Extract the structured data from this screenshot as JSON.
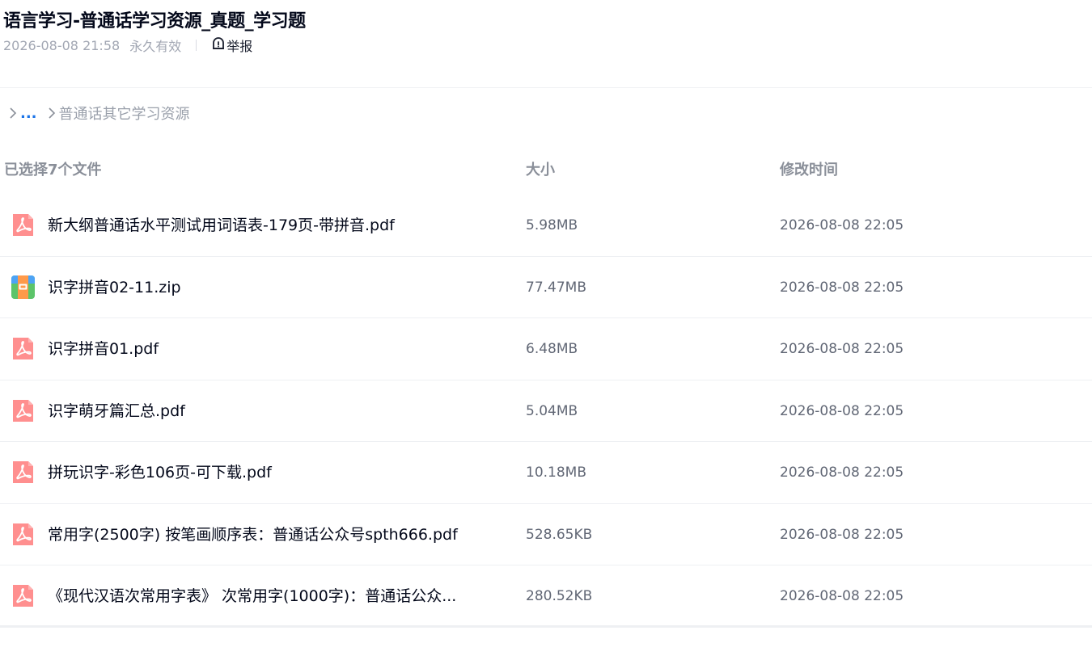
{
  "share": {
    "title": "语言学习-普通话学习资源_真题_学习题",
    "date": "2026-08-08 21:58",
    "validity": "永久有效",
    "report_label": "举报"
  },
  "breadcrumb": {
    "more": "...",
    "current": "普通话其它学习资源"
  },
  "columns": {
    "name": "已选择7个文件",
    "size": "大小",
    "time": "修改时间"
  },
  "files": [
    {
      "name": "新大纲普通话水平测试用词语表-179页-带拼音.pdf",
      "size": "5.98MB",
      "time": "2026-08-08 22:05",
      "icon": "pdf-icon"
    },
    {
      "name": "识字拼音02-11.zip",
      "size": "77.47MB",
      "time": "2026-08-08 22:05",
      "icon": "zip-icon"
    },
    {
      "name": "识字拼音01.pdf",
      "size": "6.48MB",
      "time": "2026-08-08 22:05",
      "icon": "pdf-icon"
    },
    {
      "name": "识字萌牙篇汇总.pdf",
      "size": "5.04MB",
      "time": "2026-08-08 22:05",
      "icon": "pdf-icon"
    },
    {
      "name": "拼玩识字-彩色106页-可下载.pdf",
      "size": "10.18MB",
      "time": "2026-08-08 22:05",
      "icon": "pdf-icon"
    },
    {
      "name": "常用字(2500字) 按笔画顺序表：普通话公众号spth666.pdf",
      "size": "528.65KB",
      "time": "2026-08-08 22:05",
      "icon": "pdf-icon"
    },
    {
      "name": "《现代汉语次常用字表》 次常用字(1000字)：普通话公众...",
      "size": "280.52KB",
      "time": "2026-08-08 22:05",
      "icon": "pdf-icon"
    }
  ],
  "colors": {
    "pdf": "#ff8f8f",
    "link": "#1a73e8"
  }
}
